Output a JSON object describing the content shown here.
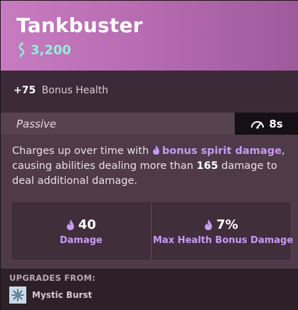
{
  "item": {
    "name": "Tankbuster",
    "cost": "3,200"
  },
  "bonus": {
    "value": "+75",
    "label": "Bonus Health"
  },
  "passive": {
    "label": "Passive",
    "cooldown": "8s"
  },
  "description": {
    "part1": "Charges up over time with ",
    "highlight": "bonus spirit damage",
    "part2": ", causing abilities dealing more than ",
    "threshold": "165",
    "part3": " damage to deal additional damage."
  },
  "stats": [
    {
      "value": "40",
      "label": "Damage"
    },
    {
      "value": "7%",
      "label": "Max Health Bonus Damage"
    }
  ],
  "upgrades": {
    "heading": "UPGRADES FROM:",
    "items": [
      {
        "name": "Mystic Burst",
        "icon": "snowflake-icon"
      }
    ]
  },
  "colors": {
    "header": "#b86cb2",
    "souls": "#8ff0d8",
    "spirit": "#c79bf2"
  }
}
